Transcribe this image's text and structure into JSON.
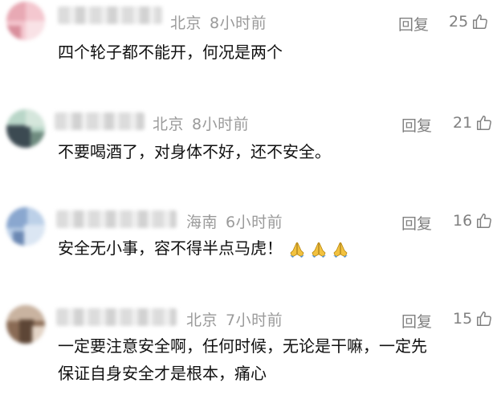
{
  "comments": [
    {
      "location": "北京",
      "time": "8小时前",
      "reply_label": "回复",
      "likes": "25",
      "text_lines": [
        "四个轮子都不能开，何况是两个"
      ],
      "avatar_colors": [
        "#f4c7cf",
        "#e8a9b4",
        "#f9e2e6",
        "#d98f9c"
      ],
      "emojis": []
    },
    {
      "location": "北京",
      "time": "8小时前",
      "reply_label": "回复",
      "likes": "21",
      "text_lines": [
        "不要喝酒了，对身体不好，还不安全。"
      ],
      "avatar_colors": [
        "#b9d6c8",
        "#3c4a52",
        "#d5e6dc",
        "#6f8c80"
      ],
      "emojis": []
    },
    {
      "location": "海南",
      "time": "6小时前",
      "reply_label": "回复",
      "likes": "16",
      "text_lines": [
        "安全无小事，容不得半点马虎！"
      ],
      "avatar_colors": [
        "#bcd0e8",
        "#8aa7cf",
        "#dbe6f3",
        "#6b88b3"
      ],
      "emojis": [
        "folded-hands",
        "folded-hands",
        "folded-hands"
      ]
    },
    {
      "location": "北京",
      "time": "7小时前",
      "reply_label": "回复",
      "likes": "15",
      "text_lines": [
        "一定要注意安全啊，任何时候，无论是干嘛，一定先",
        "保证自身安全才是根本，痛心"
      ],
      "avatar_colors": [
        "#8a6b55",
        "#c9b3a0",
        "#5d4636",
        "#e3d4c6"
      ],
      "emojis": []
    }
  ]
}
